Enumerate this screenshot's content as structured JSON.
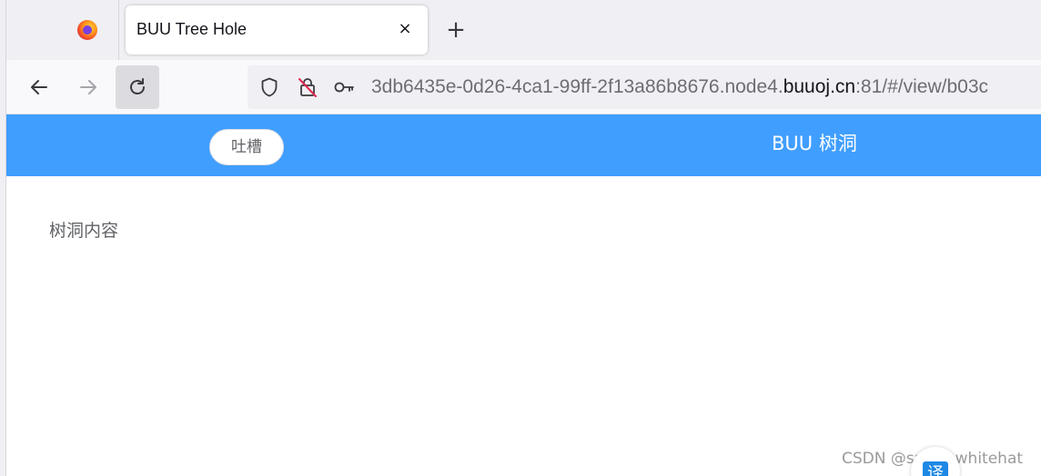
{
  "browser": {
    "tab": {
      "title": "BUU Tree Hole",
      "close_glyph": "×"
    },
    "new_tab_glyph": "+",
    "url": {
      "prefix": "3db6435e-0d26-4ca1-99ff-2f13a86b8676.node4.",
      "domain": "buuoj.cn",
      "suffix": ":81/#/view/b03c"
    },
    "icons": {
      "firefox": "firefox-logo-icon",
      "back": "arrow-left-icon",
      "forward": "arrow-right-icon",
      "reload": "reload-icon",
      "shield": "shield-icon",
      "lock": "insecure-lock-icon",
      "key": "key-icon"
    }
  },
  "app": {
    "header_color": "#409eff",
    "tucao_button": "吐槽",
    "title": "BUU 树洞",
    "content": "树洞内容"
  },
  "overlay": {
    "watermark": "CSDN @small_whitehat",
    "translate_glyph": "译"
  }
}
